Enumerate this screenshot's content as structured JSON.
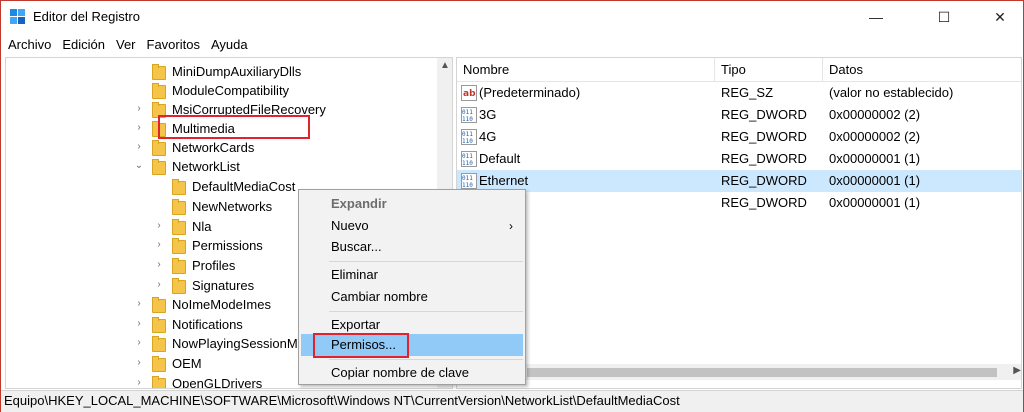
{
  "window": {
    "title": "Editor del Registro",
    "min_glyph": "—",
    "max_glyph": "☐",
    "close_glyph": "✕"
  },
  "menubar": [
    "Archivo",
    "Edición",
    "Ver",
    "Favoritos",
    "Ayuda"
  ],
  "tree": {
    "items": [
      {
        "label": "MiniDumpAuxiliaryDlls",
        "expander": ""
      },
      {
        "label": "ModuleCompatibility",
        "expander": ""
      },
      {
        "label": "MsiCorruptedFileRecovery",
        "expander": ">"
      },
      {
        "label": "Multimedia",
        "expander": ">"
      },
      {
        "label": "NetworkCards",
        "expander": ">"
      },
      {
        "label": "NetworkList",
        "expander": "v"
      },
      {
        "label": "DefaultMediaCost",
        "expander": ""
      },
      {
        "label": "NewNetworks",
        "expander": ""
      },
      {
        "label": "Nla",
        "expander": ">"
      },
      {
        "label": "Permissions",
        "expander": ">"
      },
      {
        "label": "Profiles",
        "expander": ">"
      },
      {
        "label": "Signatures",
        "expander": ">"
      },
      {
        "label": "NoImeModeImes",
        "expander": ">"
      },
      {
        "label": "Notifications",
        "expander": ">"
      },
      {
        "label": "NowPlayingSessionManager",
        "expander": ">"
      },
      {
        "label": "OEM",
        "expander": ">"
      },
      {
        "label": "OpenGLDrivers",
        "expander": ">"
      }
    ],
    "scroll_up_glyph": "▲"
  },
  "list": {
    "columns": [
      "Nombre",
      "Tipo",
      "Datos"
    ],
    "rows": [
      {
        "name": "(Predeterminado)",
        "type": "REG_SZ",
        "data": "(valor no establecido)",
        "icon": "string-value-icon"
      },
      {
        "name": "3G",
        "type": "REG_DWORD",
        "data": "0x00000002 (2)",
        "icon": "binary-value-icon"
      },
      {
        "name": "4G",
        "type": "REG_DWORD",
        "data": "0x00000002 (2)",
        "icon": "binary-value-icon"
      },
      {
        "name": "Default",
        "type": "REG_DWORD",
        "data": "0x00000001 (1)",
        "icon": "binary-value-icon"
      },
      {
        "name": "Ethernet",
        "type": "REG_DWORD",
        "data": "0x00000001 (1)",
        "icon": "binary-value-icon"
      },
      {
        "name": "",
        "type": "REG_DWORD",
        "data": "0x00000001 (1)",
        "icon": ""
      }
    ],
    "selected_index": 4,
    "scroll_right_glyph": "▶"
  },
  "context_menu": {
    "expand": "Expandir",
    "new": "Nuevo",
    "new_arrow": "›",
    "find": "Buscar...",
    "delete": "Eliminar",
    "rename": "Cambiar nombre",
    "export": "Exportar",
    "permissions": "Permisos...",
    "copy_key_name": "Copiar nombre de clave"
  },
  "statusbar": {
    "path": "Equipo\\HKEY_LOCAL_MACHINE\\SOFTWARE\\Microsoft\\Windows NT\\CurrentVersion\\NetworkList\\DefaultMediaCost"
  },
  "colors": {
    "highlight_border": "#e0232e",
    "selection_bg": "#cce8ff",
    "menu_hover": "#91c9f7"
  }
}
